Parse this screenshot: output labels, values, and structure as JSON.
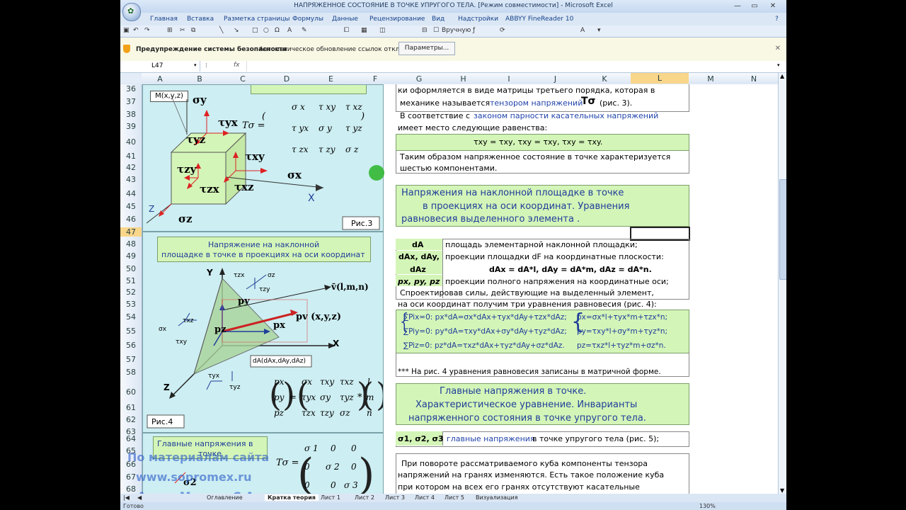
{
  "window": {
    "title": "НАПРЯЖЕННОЕ СОСТОЯНИЕ В ТОЧКЕ УПРУГОГО ТЕЛА.  [Режим совместимости] - Microsoft Excel",
    "controls": [
      "—",
      "▭",
      "✕"
    ]
  },
  "ribbon": {
    "tabs": [
      "Главная",
      "Вставка",
      "Разметка страницы",
      "Формулы",
      "Данные",
      "Рецензирование",
      "Вид",
      "Надстройки",
      "ABBYY FineReader 10"
    ]
  },
  "qat": {
    "manual_label": "Вручную"
  },
  "security": {
    "label": "Предупреждение системы безопасности",
    "message": "Автоматическое обновление ссылок отключено",
    "button": "Параметры..."
  },
  "formula_bar": {
    "cell": "L47",
    "fx": "fx",
    "value": ""
  },
  "columns": [
    "A",
    "B",
    "C",
    "D",
    "E",
    "F",
    "G",
    "H",
    "I",
    "J",
    "K",
    "L",
    "M",
    "N"
  ],
  "selected_column": "L",
  "rows": [
    "36",
    "37",
    "38",
    "39",
    "40",
    "41",
    "42",
    "43",
    "44",
    "45",
    "46",
    "47",
    "48",
    "49",
    "50",
    "51",
    "52",
    "53",
    "54",
    "55",
    "56",
    "57",
    "58",
    "60",
    "61",
    "62",
    "63",
    "64",
    "65",
    "66",
    "67",
    "68"
  ],
  "selected_row": "47",
  "fig3": {
    "point": "M(x,y,z)",
    "sigma_y": "σy",
    "tau_yx": "τyx",
    "tau_yz": "τyz",
    "tau_xy": "τxy",
    "tau_zy": "τzy",
    "tau_zx": "τzx",
    "tau_xz": "τxz",
    "sigma_x": "σx",
    "sigma_z": "σz",
    "axis_x": "X",
    "axis_z": "Z",
    "matrix_lhs": "Tσ =",
    "matrix": [
      [
        "σ x",
        "τ xy",
        "τ xz"
      ],
      [
        "τ yx",
        "σ y",
        "τ yz"
      ],
      [
        "τ zx",
        "τ zy",
        "σ z"
      ]
    ],
    "caption": "Рис.3"
  },
  "fig4": {
    "title_line1": "Напряжение  на наклонной",
    "title_line2": "площадке в точке в проекциях  на оси координат",
    "axis_y": "Y",
    "axis_x": "X",
    "axis_z": "Z",
    "normal": "v̄(l,m,n)",
    "p_y": "py",
    "p_z": "pz",
    "p_x": "px",
    "p_v": "pv (x,y,z)",
    "tzx": "τzx",
    "sz": "σz",
    "tzy": "τzy",
    "txz": "τxz",
    "sx": "σx",
    "txy": "τxy",
    "tyx": "τyx",
    "tyz": "τyz",
    "area_label": "dA(dAx,dAy,dAz)",
    "vec_p": [
      "px",
      "py",
      "pz"
    ],
    "matrix": [
      [
        "σx",
        "τxy",
        "τxz"
      ],
      [
        "τyx",
        "σy",
        "τyz"
      ],
      [
        "τzx",
        "τzy",
        "σz"
      ]
    ],
    "vec_n": [
      "l",
      "m",
      "n"
    ],
    "caption": "Рис.4"
  },
  "fig5": {
    "title_line1": "Главные напряжения  в",
    "title_line2": "точке",
    "matrix_lhs": "Tσ =",
    "matrix": [
      [
        "σ 1",
        "0",
        "0"
      ],
      [
        "0",
        "σ 2",
        "0"
      ],
      [
        "0",
        "0",
        "σ 3"
      ]
    ],
    "sigma2": "σ2"
  },
  "text": {
    "l36": "ки оформляется в виде матрицы третьего порядка, которая в",
    "l37a": "механике называется",
    "l37b": "тензором напряжений",
    "l37c": "Tσ",
    "l37d": "(рис. 3).",
    "l38a": "В соответствие с",
    "l38b": "законом парности касательных напряжений",
    "l39": "имеет место следующие равенства:",
    "l40": "τxy = τxy,  τxy = τxy,  τxy = τxy.",
    "l41": "Таким образом напряженное состояние в точке характеризуется",
    "l42": "шестью компонентами.",
    "box1_l1": "Напряжения на наклонной площадке в точке",
    "box1_l2": "в проекциях на оси координат. Уравнения",
    "box1_l3": "равновесия выделенного элемента .",
    "r48_k": "dA",
    "r48_v": "площадь элементарной наклонной площадки;",
    "r49_k": "dAx, dAy,",
    "r49_v": "проекции площадки dF на координатные плоскости:",
    "r50_k": "dAz",
    "r50_v": "dAx = dA*l, dAy = dA*m, dAz = dA*n.",
    "r51_k": "px, py, pz",
    "r51_v": "проекции полного напряжения на координатные оси;",
    "l52": "Спроектировав силы, действующие на выделенный элемент,",
    "l53": "на оси координат получим три уравнения равновесия (рис. 4):",
    "eq1": "∑Pix=0:  px*dA=σx*dAx+τyx*dAy+τzx*dAz;",
    "eq2": "∑Piy=0:  py*dA=τxy*dAx+σy*dAy+τyz*dAz;",
    "eq3": "∑Piz=0:  pz*dA=τxz*dAx+τyz*dAy+σz*dAz.",
    "eq4": "px=σx*l+τyx*m+τzx*n;",
    "eq5": "py=τxy*l+σy*m+τyz*n;",
    "eq6": "pz=τxz*l+τyz*m+σz*n.",
    "l58": "*** На рис. 4 уравнения равновесия записаны в матричной форме.",
    "box2_l1": "Главные напряжения в точке.",
    "box2_l2": "Характеристическое уравнение. Инварианты",
    "box2_l3": "напряженного состояния в точке упругого тела.",
    "r64_k": "σ1, σ2, σ3",
    "r64_v1": "главные напряжения",
    "r64_v2": "в точке упругого тела (рис. 5);",
    "l66": "При повороте рассматриваемого куба компоненты тензора",
    "l67": "напряжений на гранях изменяются. Есть такое положение куба",
    "l68": "при котором на всех его гранях отсутствуют касательные"
  },
  "watermark": {
    "l1": "По материалам сайта",
    "l2": "www.sopromex.ru",
    "l3": "Автор Макеев С.А."
  },
  "sheets": [
    "Оглавление",
    "Кратка теория",
    "Лист 1",
    "Лист 2",
    "Лист 3",
    "Лист 4",
    "Лист 5",
    "Визуализация"
  ],
  "active_sheet": "Кратка теория",
  "status": {
    "ready": "Готово",
    "zoom": "130%"
  }
}
